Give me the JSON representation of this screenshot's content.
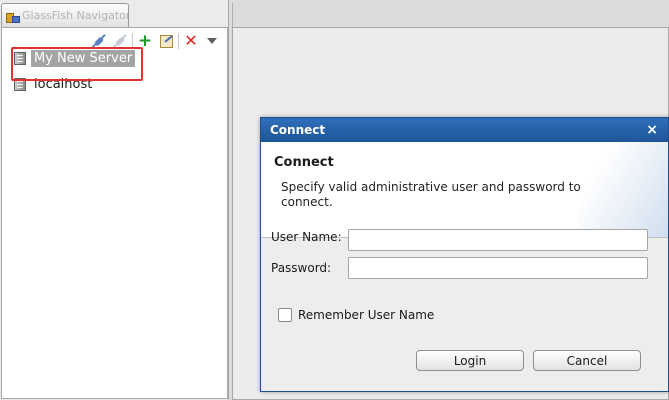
{
  "left_panel": {
    "tab_title": "GlassFish Navigator",
    "toolbar": {
      "connect_icon": "plug-icon",
      "disconnect_icon": "plug-icon",
      "add_icon": "plus-icon",
      "edit_icon": "edit-icon",
      "delete_icon": "delete-icon",
      "menu_icon": "dropdown-icon"
    },
    "tree": [
      {
        "label": "My New Server",
        "selected": true
      },
      {
        "label": "localhost",
        "selected": false
      }
    ]
  },
  "dialog": {
    "title": "Connect",
    "close_glyph": "×",
    "heading": "Connect",
    "description": "Specify valid administrative user and password to connect.",
    "username_label": "User Name:",
    "username_value": "",
    "password_label": "Password:",
    "password_value": "",
    "remember_label": "Remember User Name",
    "remember_checked": false,
    "login_label": "Login",
    "cancel_label": "Cancel"
  },
  "colors": {
    "titlebar": "#2563a8",
    "highlight_border": "#e23333",
    "selected_bg": "#a4a4a4"
  }
}
